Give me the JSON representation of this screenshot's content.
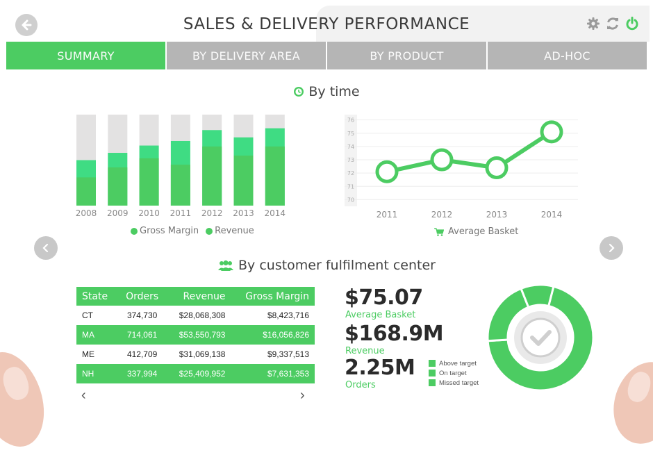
{
  "header": {
    "title": "SALES & DELIVERY PERFORMANCE"
  },
  "tabs": [
    {
      "label": "SUMMARY",
      "active": true
    },
    {
      "label": "BY DELIVERY AREA",
      "active": false
    },
    {
      "label": "BY PRODUCT",
      "active": false
    },
    {
      "label": "AD-HOC",
      "active": false
    }
  ],
  "icons": {
    "back": "arrow-left-icon",
    "settings": "gear-icon",
    "refresh": "refresh-icon",
    "power": "power-icon",
    "clock": "clock-icon",
    "users": "users-icon",
    "cart": "cart-icon",
    "check": "check-icon"
  },
  "colors": {
    "accent": "#4ccc62",
    "accent_light": "#3fdc83",
    "tab_inactive": "#b5b5b5",
    "bar_bg": "#e3e2e2"
  },
  "sections": {
    "by_time": "By time",
    "by_center": "By customer fulfilment center"
  },
  "chart_data": [
    {
      "type": "bar",
      "categories": [
        "2008",
        "2009",
        "2010",
        "2011",
        "2012",
        "2013",
        "2014"
      ],
      "series": [
        {
          "name": "Gross Margin",
          "values": [
            31,
            42,
            52,
            45,
            65,
            55,
            65
          ]
        },
        {
          "name": "Revenue",
          "values": [
            50,
            58,
            66,
            71,
            83,
            75,
            85
          ]
        }
      ],
      "ylim": [
        0,
        100
      ],
      "legend": [
        "Gross Margin",
        "Revenue"
      ]
    },
    {
      "type": "line",
      "x": [
        "2011",
        "2012",
        "2013",
        "2014"
      ],
      "series": [
        {
          "name": "Average Basket",
          "values": [
            72.1,
            73.0,
            72.4,
            75.1
          ]
        }
      ],
      "yticks": [
        "70",
        "71",
        "72",
        "73",
        "74",
        "75",
        "76"
      ],
      "ylim": [
        69.5,
        76.4
      ],
      "legend": [
        "Average Basket"
      ]
    },
    {
      "type": "pie",
      "categories": [
        "Above target",
        "On target",
        "Missed target"
      ],
      "values": [
        70,
        20,
        10
      ]
    }
  ],
  "table": {
    "headers": [
      "State",
      "Orders",
      "Revenue",
      "Gross Margin"
    ],
    "rows": [
      [
        "CT",
        "374,730",
        "$28,068,308",
        "$8,423,716"
      ],
      [
        "MA",
        "714,061",
        "$53,550,793",
        "$16,056,826"
      ],
      [
        "ME",
        "412,709",
        "$31,069,138",
        "$9,337,513"
      ],
      [
        "NH",
        "337,994",
        "$25,409,952",
        "$7,631,353"
      ]
    ],
    "prev": "‹",
    "next": "›"
  },
  "kpis": [
    {
      "value": "$75.07",
      "label": "Average Basket"
    },
    {
      "value": "$168.9M",
      "label": "Revenue"
    },
    {
      "value": "2.25M",
      "label": "Orders"
    }
  ],
  "donut_legend": [
    "Above target",
    "On target",
    "Missed target"
  ]
}
